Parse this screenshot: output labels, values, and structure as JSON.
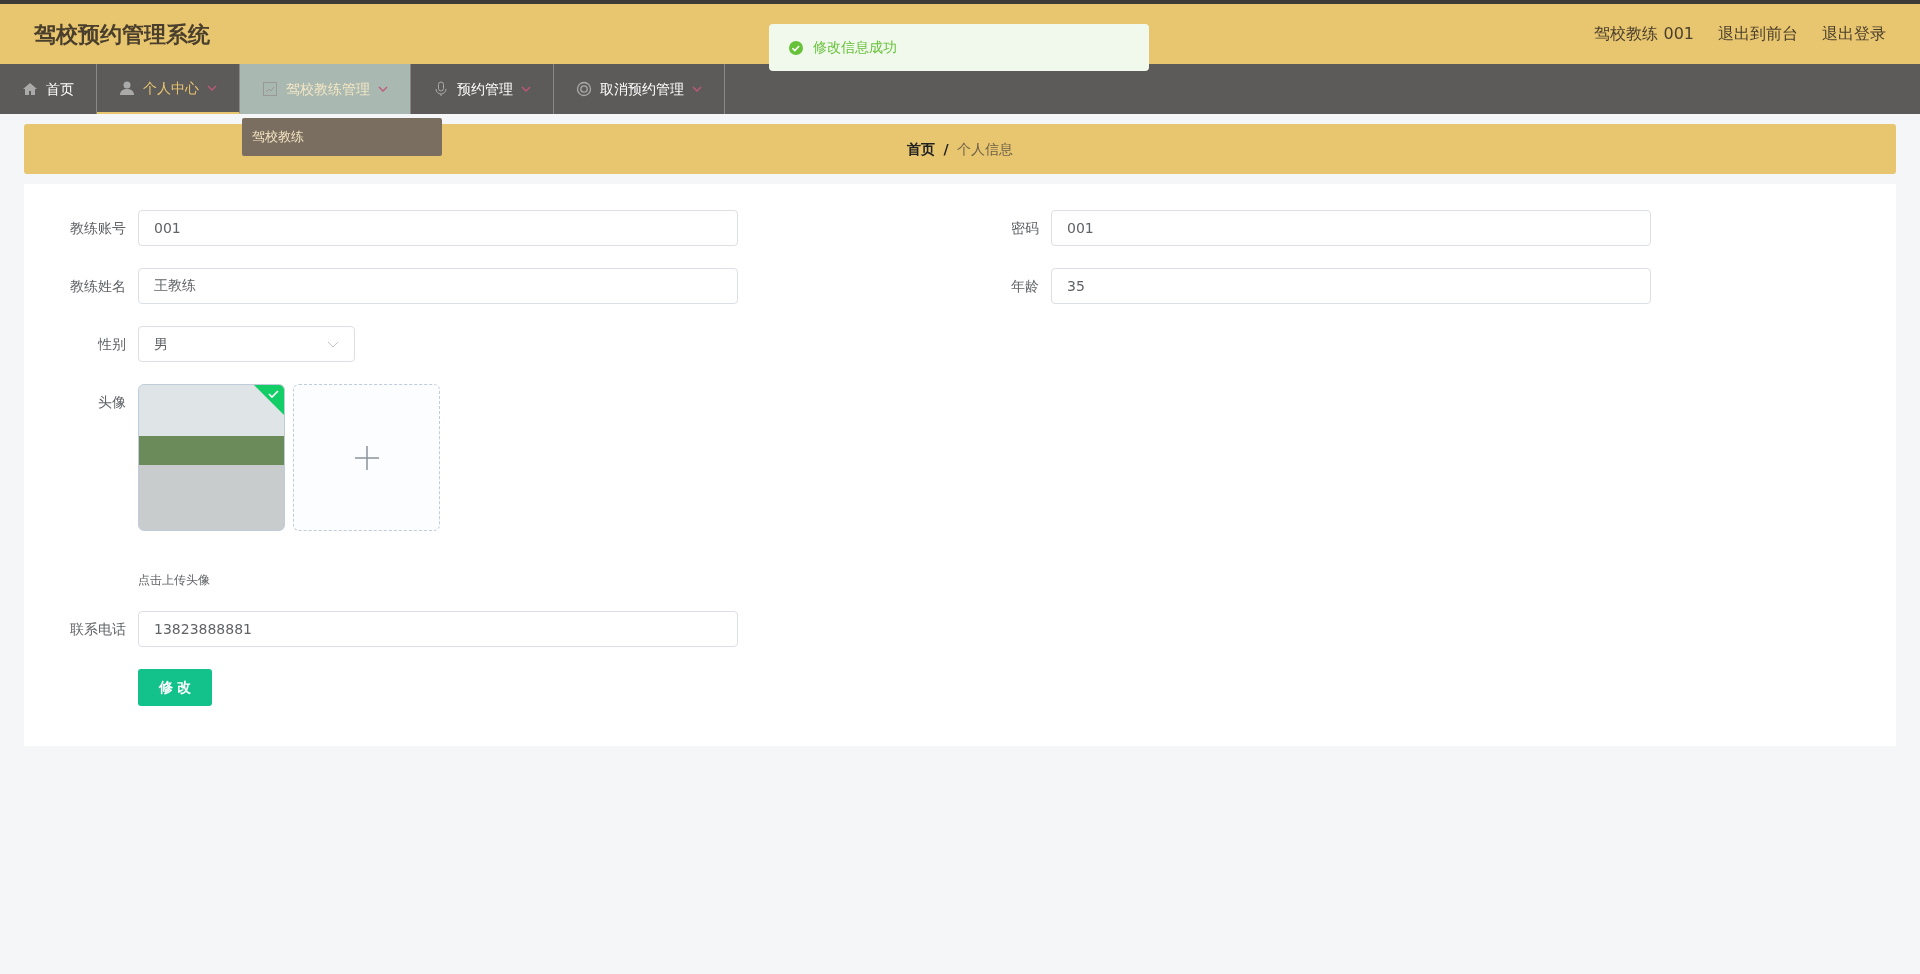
{
  "header": {
    "title": "驾校预约管理系统",
    "user": "驾校教练 001",
    "links": [
      "退出到前台",
      "退出登录"
    ]
  },
  "toast": {
    "kind": "success",
    "message": "修改信息成功"
  },
  "nav": [
    {
      "label": "首页",
      "has_menu": false,
      "selected": false,
      "hovered": false
    },
    {
      "label": "个人中心",
      "has_menu": true,
      "selected": true,
      "hovered": false
    },
    {
      "label": "驾校教练管理",
      "has_menu": true,
      "selected": false,
      "hovered": true,
      "submenu": [
        "驾校教练"
      ]
    },
    {
      "label": "预约管理",
      "has_menu": true,
      "selected": false,
      "hovered": false
    },
    {
      "label": "取消预约管理",
      "has_menu": true,
      "selected": false,
      "hovered": false
    }
  ],
  "breadcrumb": {
    "items": [
      "首页",
      "个人信息"
    ],
    "separator": "/"
  },
  "form": {
    "rows": [
      [
        {
          "label": "教练账号",
          "kind": "text",
          "value": "001"
        },
        {
          "label": "密码",
          "kind": "text",
          "value": "001"
        }
      ],
      [
        {
          "label": "教练姓名",
          "kind": "text",
          "value": "王教练"
        },
        {
          "label": "年龄",
          "kind": "text",
          "value": "35"
        }
      ],
      [
        {
          "label": "性别",
          "kind": "select",
          "value": "男"
        }
      ],
      [
        {
          "label": "头像",
          "kind": "upload",
          "uploaded": true,
          "hint": "点击上传头像"
        }
      ],
      [
        {
          "label": "联系电话",
          "kind": "text",
          "value": "13823888881"
        }
      ]
    ],
    "submit": "修 改"
  }
}
